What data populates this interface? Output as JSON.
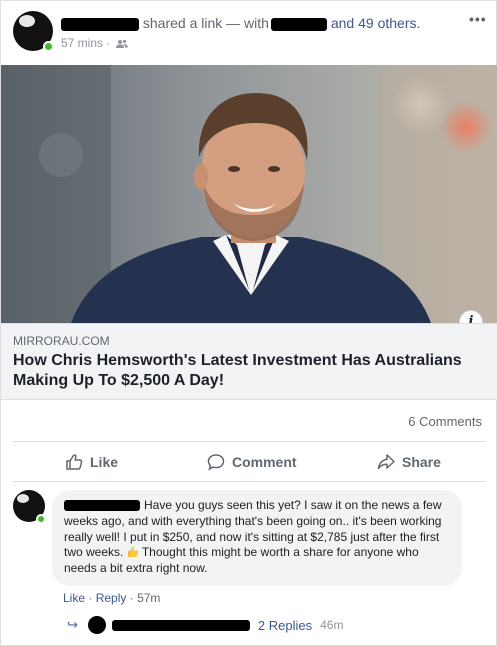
{
  "post": {
    "shared_text": "shared a link",
    "with_text": "— with",
    "others_text": "and 49 others.",
    "timestamp": "57 mins",
    "audience_icon": "friends-icon",
    "more_icon": "more-horizontal-icon"
  },
  "link_preview": {
    "domain": "MIRRORAU.COM",
    "title": "How Chris Hemsworth's Latest Investment Has Australians Making Up To $2,500 A Day!",
    "info_icon": "i"
  },
  "stats": {
    "comments": "6 Comments"
  },
  "actions": {
    "like": "Like",
    "comment": "Comment",
    "share": "Share"
  },
  "comment": {
    "text_before": "Have you guys seen this yet? I saw it on the news a few weeks ago, and with everything that's been going on.. it's been working really well! I put in $250, and now it's sitting at $2,785 just after the first two weeks.",
    "text_after": " Thought this might be worth a share for anyone who needs a bit extra right now.",
    "like": "Like",
    "reply": "Reply",
    "time": "57m",
    "sep": "·"
  },
  "replies": {
    "link": "2 Replies",
    "time": "46m"
  },
  "colors": {
    "link_blue": "#385898",
    "online_green": "#42b72a",
    "meta_gray": "#606770"
  }
}
